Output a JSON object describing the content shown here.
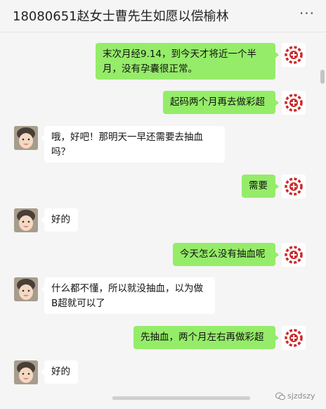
{
  "header": {
    "title": "18080651赵女士曹先生如愿以偿榆林",
    "more_label": "···"
  },
  "messages": [
    {
      "sender": "me",
      "text": "末次月经9.14，到今天才将近一个半月，没有孕囊很正常。"
    },
    {
      "sender": "me",
      "text": "起码两个月再去做彩超"
    },
    {
      "sender": "other",
      "text": "哦，好吧！那明天一早还需要去抽血吗？"
    },
    {
      "sender": "me",
      "text": "需要"
    },
    {
      "sender": "other",
      "text": "好的"
    },
    {
      "sender": "me",
      "text": "今天怎么没有抽血呢"
    },
    {
      "sender": "other",
      "text": "什么都不懂，所以就没抽血，以为做B超就可以了"
    },
    {
      "sender": "me",
      "text": "先抽血，两个月左右再做彩超"
    },
    {
      "sender": "other",
      "text": "好的"
    }
  ],
  "watermark": {
    "text": "sjzdszy"
  },
  "colors": {
    "background": "#f5f5f5",
    "my_bubble": "#95ec69",
    "other_bubble": "#ffffff"
  }
}
